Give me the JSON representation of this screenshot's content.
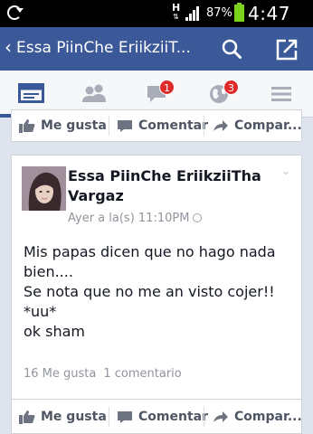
{
  "status_bar": {
    "network": "H",
    "battery_percent": "87%",
    "time": "4:47 PM"
  },
  "app_bar": {
    "back_glyph": "‹",
    "title": "Essa PiinChe EriikziiT..."
  },
  "tabs": [
    {
      "name": "news-feed",
      "icon": "news-feed-icon",
      "active": true
    },
    {
      "name": "friend-requests",
      "icon": "friends-icon",
      "active": false
    },
    {
      "name": "messages",
      "icon": "chat-bubble-icon",
      "badge": "1"
    },
    {
      "name": "notifications",
      "icon": "globe-icon",
      "badge": "3"
    },
    {
      "name": "more",
      "icon": "hamburger-menu-icon",
      "active": false
    }
  ],
  "actions": {
    "like": "Me gusta",
    "comment": "Comentar",
    "share": "Compar..."
  },
  "post": {
    "author": "Essa PiinChe EriikziiTha Vargaz",
    "timestamp": "Ayer a la(s) 11:10PM",
    "text_lines": [
      "Mis papas dicen que no hago nada",
      "bien....",
      "Se nota que no me an visto cojer!!",
      "*uu*",
      "ok sham"
    ],
    "likes": "16 Me gusta",
    "comments": "1 comentario"
  },
  "colors": {
    "brand": "#3b5998",
    "badge": "#e02a2a",
    "battery": "#7bd11b",
    "background": "#dfe3ee"
  }
}
